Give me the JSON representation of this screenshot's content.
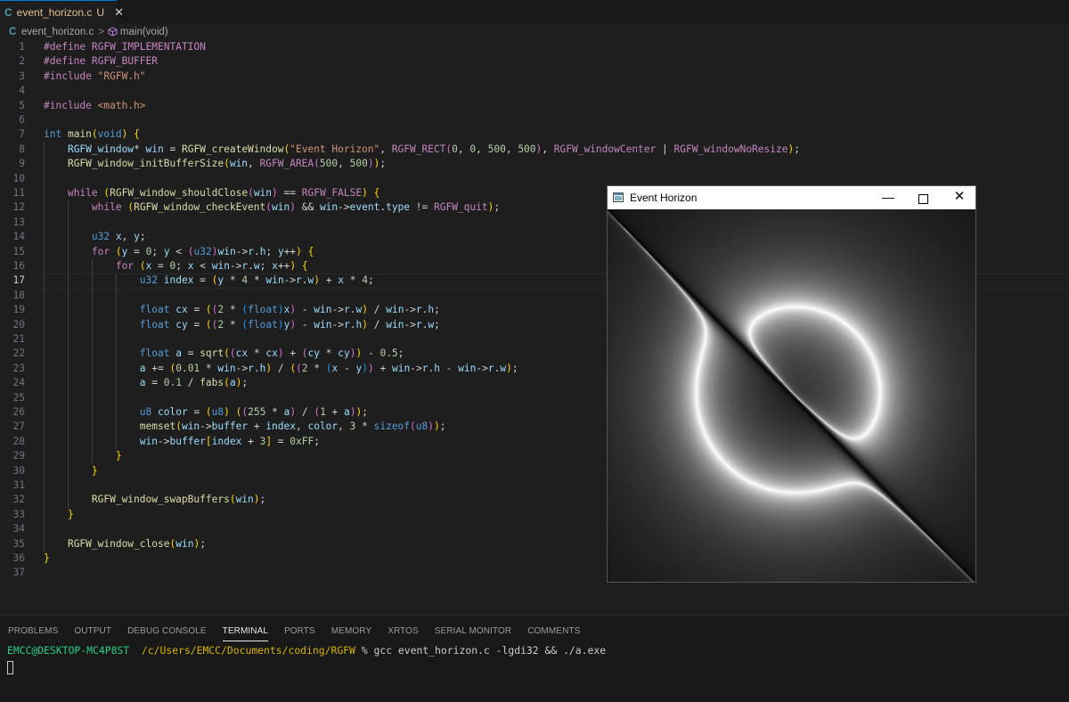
{
  "tab": {
    "icon": "C",
    "filename": "event_horizon.c",
    "status": "U",
    "close": "✕"
  },
  "breadcrumb": {
    "icon": "C",
    "file": "event_horizon.c",
    "sep": ">",
    "symbol": "main(void)"
  },
  "code_lines": [
    "#define RGFW_IMPLEMENTATION",
    "#define RGFW_BUFFER",
    "#include \"RGFW.h\"",
    "",
    "#include <math.h>",
    "",
    "int main(void) {",
    "    RGFW_window* win = RGFW_createWindow(\"Event Horizon\", RGFW_RECT(0, 0, 500, 500), RGFW_windowCenter | RGFW_windowNoResize);",
    "    RGFW_window_initBufferSize(win, RGFW_AREA(500, 500));",
    "",
    "    while (RGFW_window_shouldClose(win) == RGFW_FALSE) {",
    "        while (RGFW_window_checkEvent(win) && win->event.type != RGFW_quit);",
    "",
    "        u32 x, y;",
    "        for (y = 0; y < (u32)win->r.h; y++) {",
    "            for (x = 0; x < win->r.w; x++) {",
    "                u32 index = (y * 4 * win->r.w) + x * 4;",
    "",
    "                float cx = ((2 * (float)x) - win->r.w) / win->r.h;",
    "                float cy = ((2 * (float)y) - win->r.h) / win->r.w;",
    "",
    "                float a = sqrt((cx * cx) + (cy * cy)) - 0.5;",
    "                a += (0.01 * win->r.h) / ((2 * (x - y)) + win->r.h - win->r.w);",
    "                a = 0.1 / fabs(a);",
    "",
    "                u8 color = (u8) ((255 * a) / (1 + a));",
    "                memset(win->buffer + index, color, 3 * sizeof(u8));",
    "                win->buffer[index + 3] = 0xFF;",
    "            }",
    "        }",
    "",
    "        RGFW_window_swapBuffers(win);",
    "    }",
    "",
    "    RGFW_window_close(win);",
    "}",
    ""
  ],
  "active_line": 17,
  "panel": {
    "tabs": [
      "PROBLEMS",
      "OUTPUT",
      "DEBUG CONSOLE",
      "TERMINAL",
      "PORTS",
      "MEMORY",
      "XRTOS",
      "SERIAL MONITOR",
      "COMMENTS"
    ],
    "active_tab": "TERMINAL"
  },
  "terminal": {
    "user": "EMCC@DESKTOP-MC4P8ST",
    "path": "/c/Users/EMCC/Documents/coding/RGFW",
    "prompt": "%",
    "command": "gcc event_horizon.c -lgdi32 && ./a.exe"
  },
  "app_window": {
    "title": "Event Horizon",
    "icon": "app-window-icon",
    "minimize": "—",
    "close": "✕"
  },
  "colors": {
    "accent": "#0078d4",
    "editor_bg": "#1e1e1e",
    "terminal_user": "#23d18b",
    "terminal_path": "#d6b400"
  }
}
